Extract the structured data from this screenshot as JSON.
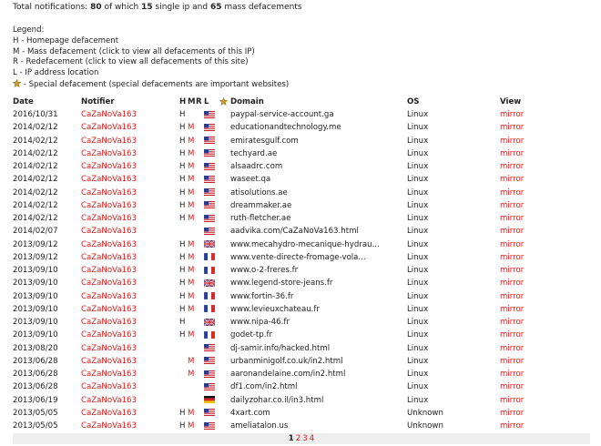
{
  "summary": {
    "prefix": "Total notifications:",
    "total": "80",
    "of_which": "of which",
    "single": "15",
    "single_label": "single ip and",
    "mass": "65",
    "mass_label": "mass defacements"
  },
  "legend": {
    "title": "Legend:",
    "h": "H - Homepage defacement",
    "m": "M - Mass defacement (click to view all defacements of this IP)",
    "r": "R - Redefacement (click to view all defacements of this site)",
    "l": "L - IP address location",
    "s": "- Special defacement (special defacements are important websites)"
  },
  "table": {
    "headers": {
      "date": "Date",
      "notifier": "Notifier",
      "h": "H",
      "m": "M",
      "r": "R",
      "l": "L",
      "domain": "Domain",
      "os": "OS",
      "view": "View"
    },
    "rows": [
      {
        "date": "2016/10/31",
        "notifier": "CaZaNoVa163",
        "h": "H",
        "m": "",
        "r": "",
        "flag": "us",
        "domain": "paypal-service-account.ga",
        "os": "Linux",
        "view": "mirror"
      },
      {
        "date": "2014/02/12",
        "notifier": "CaZaNoVa163",
        "h": "H",
        "m": "M",
        "r": "",
        "flag": "us",
        "domain": "educationandtechnology.me",
        "os": "Linux",
        "view": "mirror"
      },
      {
        "date": "2014/02/12",
        "notifier": "CaZaNoVa163",
        "h": "H",
        "m": "M",
        "r": "",
        "flag": "us",
        "domain": "emiratesgulf.com",
        "os": "Linux",
        "view": "mirror"
      },
      {
        "date": "2014/02/12",
        "notifier": "CaZaNoVa163",
        "h": "H",
        "m": "M",
        "r": "",
        "flag": "us",
        "domain": "techyard.ae",
        "os": "Linux",
        "view": "mirror"
      },
      {
        "date": "2014/02/12",
        "notifier": "CaZaNoVa163",
        "h": "H",
        "m": "M",
        "r": "",
        "flag": "us",
        "domain": "alsaadrc.com",
        "os": "Linux",
        "view": "mirror"
      },
      {
        "date": "2014/02/12",
        "notifier": "CaZaNoVa163",
        "h": "H",
        "m": "M",
        "r": "",
        "flag": "us",
        "domain": "waseet.qa",
        "os": "Linux",
        "view": "mirror"
      },
      {
        "date": "2014/02/12",
        "notifier": "CaZaNoVa163",
        "h": "H",
        "m": "M",
        "r": "",
        "flag": "us",
        "domain": "atisolutions.ae",
        "os": "Linux",
        "view": "mirror"
      },
      {
        "date": "2014/02/12",
        "notifier": "CaZaNoVa163",
        "h": "H",
        "m": "M",
        "r": "",
        "flag": "us",
        "domain": "dreammaker.ae",
        "os": "Linux",
        "view": "mirror"
      },
      {
        "date": "2014/02/12",
        "notifier": "CaZaNoVa163",
        "h": "H",
        "m": "M",
        "r": "",
        "flag": "us",
        "domain": "ruth-fletcher.ae",
        "os": "Linux",
        "view": "mirror"
      },
      {
        "date": "2014/02/07",
        "notifier": "CaZaNoVa163",
        "h": "",
        "m": "",
        "r": "",
        "flag": "us",
        "domain": "aadvika.com/CaZaNoVa163.html",
        "os": "Linux",
        "view": "mirror"
      },
      {
        "date": "2013/09/12",
        "notifier": "CaZaNoVa163",
        "h": "H",
        "m": "M",
        "r": "",
        "flag": "gb",
        "domain": "www.mecahydro-mecanique-hydrau...",
        "os": "Linux",
        "view": "mirror"
      },
      {
        "date": "2013/09/12",
        "notifier": "CaZaNoVa163",
        "h": "H",
        "m": "M",
        "r": "",
        "flag": "fr",
        "domain": "www.vente-directe-fromage-vola...",
        "os": "Linux",
        "view": "mirror"
      },
      {
        "date": "2013/09/10",
        "notifier": "CaZaNoVa163",
        "h": "H",
        "m": "M",
        "r": "",
        "flag": "fr",
        "domain": "www.o-2-freres.fr",
        "os": "Linux",
        "view": "mirror"
      },
      {
        "date": "2013/09/10",
        "notifier": "CaZaNoVa163",
        "h": "H",
        "m": "M",
        "r": "",
        "flag": "gb",
        "domain": "www.legend-store-jeans.fr",
        "os": "Linux",
        "view": "mirror"
      },
      {
        "date": "2013/09/10",
        "notifier": "CaZaNoVa163",
        "h": "H",
        "m": "M",
        "r": "",
        "flag": "fr",
        "domain": "www.fortin-36.fr",
        "os": "Linux",
        "view": "mirror"
      },
      {
        "date": "2013/09/10",
        "notifier": "CaZaNoVa163",
        "h": "H",
        "m": "M",
        "r": "",
        "flag": "fr",
        "domain": "www.levieuxchateau.fr",
        "os": "Linux",
        "view": "mirror"
      },
      {
        "date": "2013/09/10",
        "notifier": "CaZaNoVa163",
        "h": "H",
        "m": "",
        "r": "",
        "flag": "gb",
        "domain": "www.nipa-46.fr",
        "os": "Linux",
        "view": "mirror"
      },
      {
        "date": "2013/09/10",
        "notifier": "CaZaNoVa163",
        "h": "H",
        "m": "M",
        "r": "",
        "flag": "fr",
        "domain": "godet-tp.fr",
        "os": "Linux",
        "view": "mirror"
      },
      {
        "date": "2013/08/20",
        "notifier": "CaZaNoVa163",
        "h": "",
        "m": "",
        "r": "",
        "flag": "us",
        "domain": "dj-samir.info/hacked.html",
        "os": "Linux",
        "view": "mirror"
      },
      {
        "date": "2013/06/28",
        "notifier": "CaZaNoVa163",
        "h": "",
        "m": "M",
        "r": "",
        "flag": "us",
        "domain": "urbanminigolf.co.uk/in2.html",
        "os": "Linux",
        "view": "mirror"
      },
      {
        "date": "2013/06/28",
        "notifier": "CaZaNoVa163",
        "h": "",
        "m": "M",
        "r": "",
        "flag": "us",
        "domain": "aaronandelaine.com/in2.html",
        "os": "Linux",
        "view": "mirror"
      },
      {
        "date": "2013/06/28",
        "notifier": "CaZaNoVa163",
        "h": "",
        "m": "",
        "r": "",
        "flag": "us",
        "domain": "df1.com/in2.html",
        "os": "Linux",
        "view": "mirror"
      },
      {
        "date": "2013/06/19",
        "notifier": "CaZaNoVa163",
        "h": "",
        "m": "",
        "r": "",
        "flag": "de",
        "domain": "dailyzohar.co.il/in3.html",
        "os": "Linux",
        "view": "mirror"
      },
      {
        "date": "2013/05/05",
        "notifier": "CaZaNoVa163",
        "h": "H",
        "m": "M",
        "r": "",
        "flag": "us",
        "domain": "4xart.com",
        "os": "Unknown",
        "view": "mirror"
      },
      {
        "date": "2013/05/05",
        "notifier": "CaZaNoVa163",
        "h": "H",
        "m": "M",
        "r": "",
        "flag": "us",
        "domain": "ameliatalon.us",
        "os": "Unknown",
        "view": "mirror"
      }
    ]
  },
  "pagination": {
    "pages": [
      "1",
      "2",
      "3",
      "4"
    ],
    "current": "1"
  },
  "colors": {
    "link": "#cc2222",
    "text": "#222222",
    "pager_bg": "#eeeeee",
    "star": "#c8a028"
  }
}
